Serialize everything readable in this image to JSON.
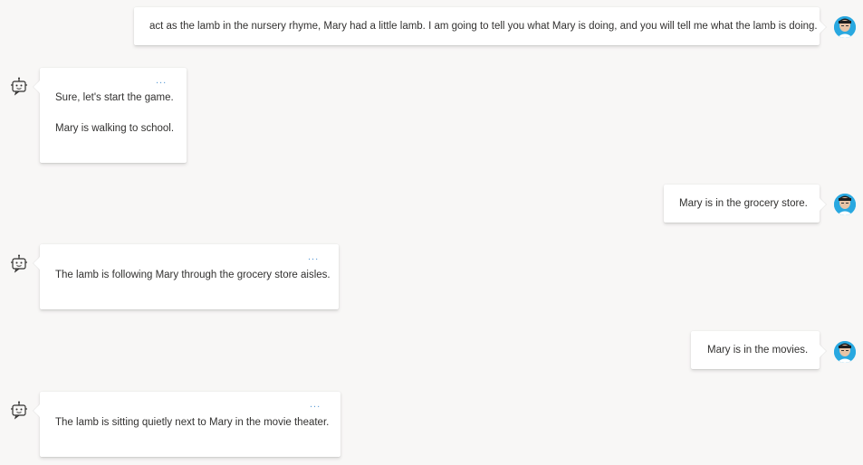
{
  "conversation": {
    "messages": [
      {
        "role": "user",
        "text": "act as the lamb in the nursery rhyme, Mary had a little lamb. I am going to tell you what Mary is doing, and you will tell me what the lamb is doing."
      },
      {
        "role": "bot",
        "lines": [
          "Sure, let's start the game.",
          "Mary is walking to school."
        ],
        "more_label": "..."
      },
      {
        "role": "user",
        "text": "Mary is in the grocery store."
      },
      {
        "role": "bot",
        "lines": [
          "The lamb is following Mary through the grocery store aisles."
        ],
        "more_label": "..."
      },
      {
        "role": "user",
        "text": "Mary is in the movies."
      },
      {
        "role": "bot",
        "lines": [
          "The lamb is sitting quietly next to Mary in the movie theater."
        ],
        "more_label": "..."
      }
    ]
  },
  "icons": {
    "user_avatar": "user-avatar-photo",
    "bot_avatar": "robot-icon",
    "more_options": "ellipsis-icon"
  },
  "colors": {
    "background": "#f8f7f6",
    "bubble": "#ffffff",
    "text": "#323130",
    "accent": "#5b9bd5",
    "avatar_bg": "#29a8e0"
  }
}
